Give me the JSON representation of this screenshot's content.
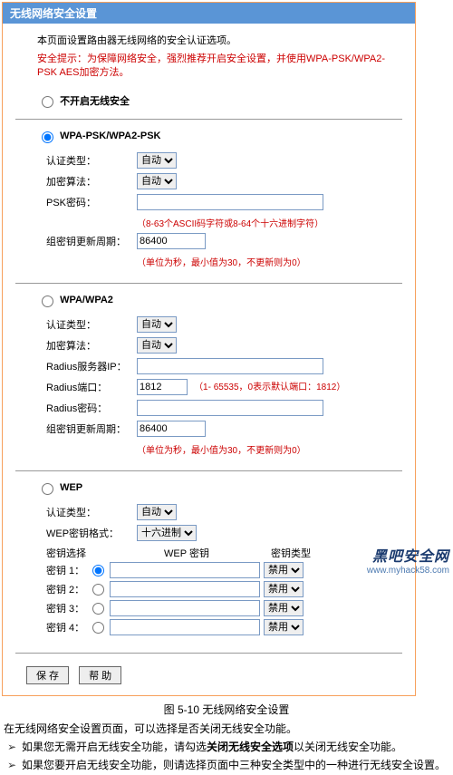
{
  "panel": {
    "title": "无线网络安全设置",
    "intro": "本页面设置路由器无线网络的安全认证选项。",
    "warning": "安全提示：为保障网络安全，强烈推荐开启安全设置，并使用WPA-PSK/WPA2-PSK AES加密方法。",
    "opt_disable": "不开启无线安全",
    "wpa_psk": {
      "title": "WPA-PSK/WPA2-PSK",
      "auth_label": "认证类型：",
      "auth_value": "自动",
      "enc_label": "加密算法：",
      "enc_value": "自动",
      "psk_label": "PSK密码：",
      "psk_value": "",
      "psk_hint": "（8-63个ASCII码字符或8-64个十六进制字符）",
      "gk_label": "组密钥更新周期：",
      "gk_value": "86400",
      "gk_hint": "（单位为秒，最小值为30，不更新则为0）"
    },
    "wpa": {
      "title": "WPA/WPA2",
      "auth_label": "认证类型：",
      "auth_value": "自动",
      "enc_label": "加密算法：",
      "enc_value": "自动",
      "radius_ip_label": "Radius服务器IP：",
      "radius_ip_value": "",
      "radius_port_label": "Radius端口：",
      "radius_port_value": "1812",
      "radius_port_hint": "（1- 65535，0表示默认端口：1812）",
      "radius_pw_label": "Radius密码：",
      "radius_pw_value": "",
      "gk_label": "组密钥更新周期：",
      "gk_value": "86400",
      "gk_hint": "（单位为秒，最小值为30，不更新则为0）"
    },
    "wep": {
      "title": "WEP",
      "auth_label": "认证类型：",
      "auth_value": "自动",
      "fmt_label": "WEP密钥格式：",
      "fmt_value": "十六进制",
      "col_select": "密钥选择",
      "col_key": "WEP 密钥",
      "col_type": "密钥类型",
      "rows": [
        {
          "label": "密钥 1：",
          "value": "",
          "type": "禁用"
        },
        {
          "label": "密钥 2：",
          "value": "",
          "type": "禁用"
        },
        {
          "label": "密钥 3：",
          "value": "",
          "type": "禁用"
        },
        {
          "label": "密钥 4：",
          "value": "",
          "type": "禁用"
        }
      ]
    },
    "save": "保 存",
    "help": "帮 助"
  },
  "caption": "图 5-10  无线网络安全设置",
  "paragraph": "在无线网络安全设置页面，可以选择是否关闭无线安全功能。",
  "bullet1_a": "如果您无需开启无线安全功能，请勾选",
  "bullet1_b": "关闭无线安全选项",
  "bullet1_c": "以关闭无线安全功能。",
  "bullet2": "如果您要开启无线安全功能，则请选择页面中三种安全类型中的一种进行无线安全设置。",
  "watermark_big": "黑吧安全网",
  "watermark_url": "www.myhack58.com"
}
